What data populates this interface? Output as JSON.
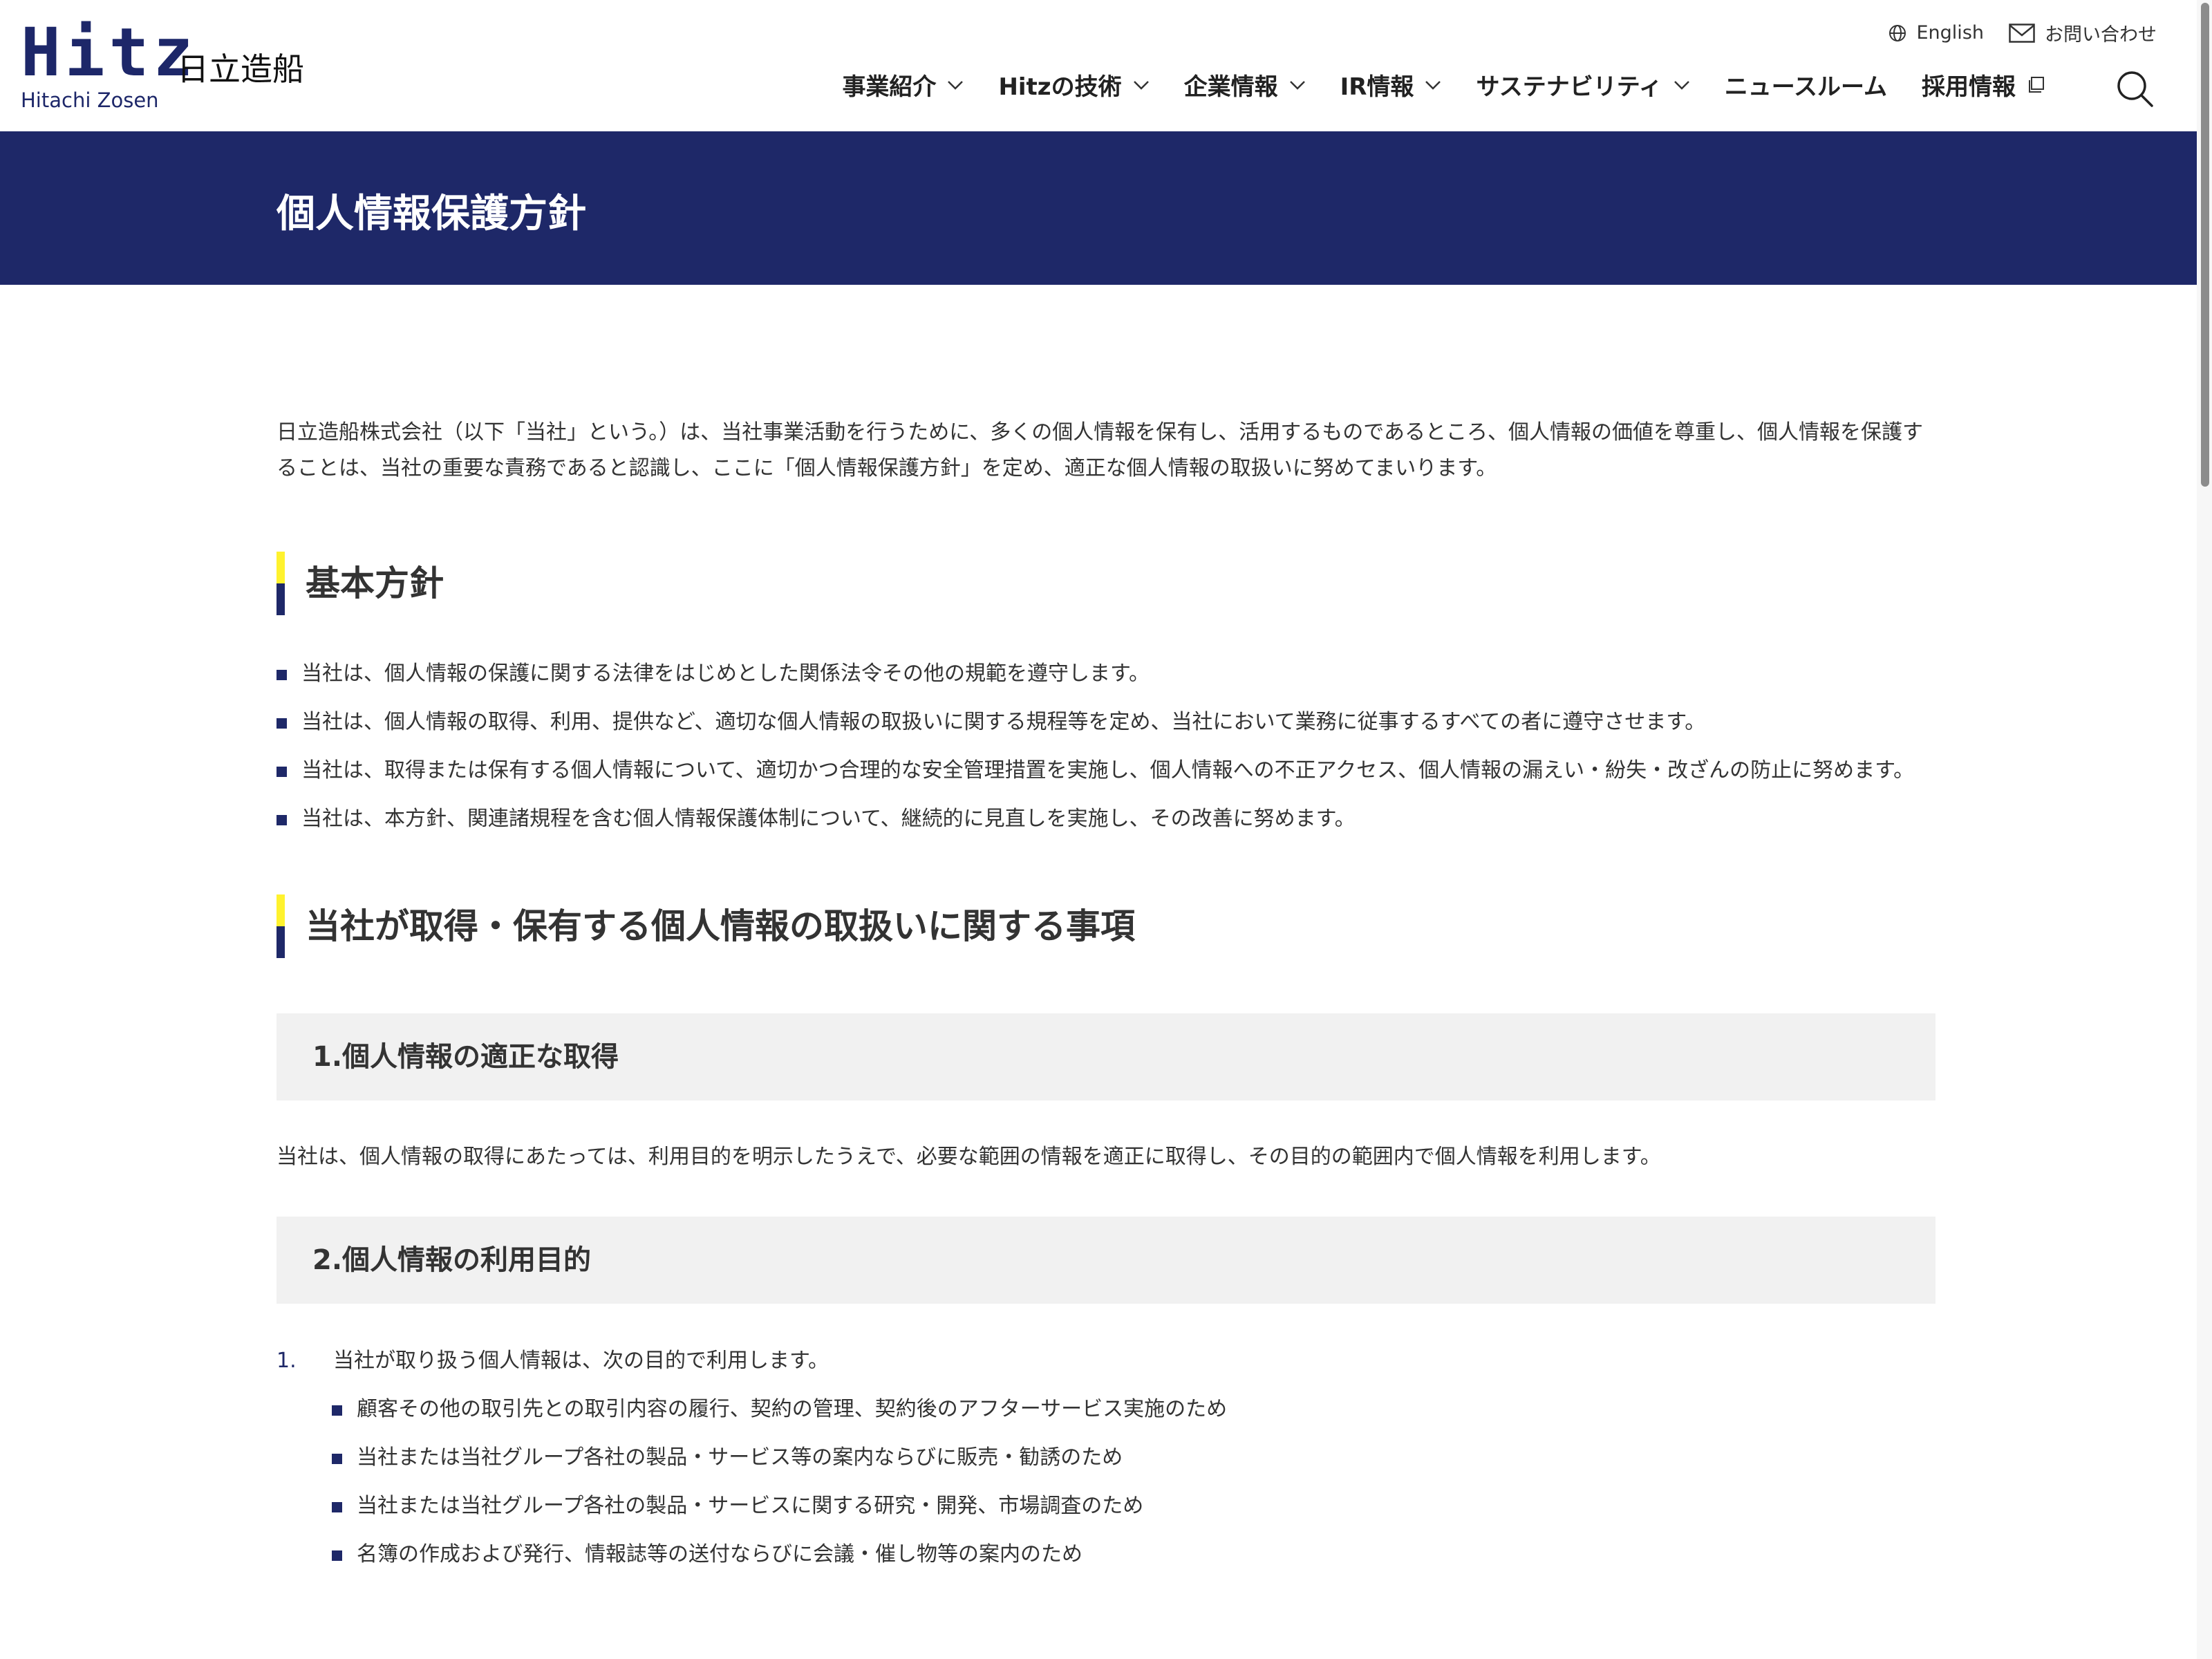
{
  "header": {
    "logo": {
      "mark": "Hitz",
      "name_jp": "日立造船",
      "name_en": "Hitachi Zosen"
    },
    "utility": {
      "english": {
        "label": "English",
        "icon": "globe-icon"
      },
      "contact": {
        "label": "お問い合わせ",
        "icon": "mail-icon"
      }
    },
    "nav": [
      {
        "label": "事業紹介",
        "dropdown": true
      },
      {
        "label": "Hitzの技術",
        "dropdown": true
      },
      {
        "label": "企業情報",
        "dropdown": true
      },
      {
        "label": "IR情報",
        "dropdown": true
      },
      {
        "label": "サステナビリティ",
        "dropdown": true
      },
      {
        "label": "ニュースルーム",
        "dropdown": false
      },
      {
        "label": "採用情報",
        "external": true
      }
    ],
    "search_icon": "search-icon"
  },
  "page_title": "個人情報保護方針",
  "intro": "日立造船株式会社（以下「当社」という。）は、当社事業活動を行うために、多くの個人情報を保有し、活用するものであるところ、個人情報の価値を尊重し、個人情報を保護することは、当社の重要な責務であると認識し、ここに「個人情報保護方針」を定め、適正な個人情報の取扱いに努めてまいります。",
  "basic_policy": {
    "heading": "基本方針",
    "items": [
      "当社は、個人情報の保護に関する法律をはじめとした関係法令その他の規範を遵守します。",
      "当社は、個人情報の取得、利用、提供など、適切な個人情報の取扱いに関する規程等を定め、当社において業務に従事するすべての者に遵守させます。",
      "当社は、取得または保有する個人情報について、適切かつ合理的な安全管理措置を実施し、個人情報への不正アクセス、個人情報の漏えい・紛失・改ざんの防止に努めます。",
      "当社は、本方針、関連諸規程を含む個人情報保護体制について、継続的に見直しを実施し、その改善に努めます。"
    ]
  },
  "handling": {
    "heading": "当社が取得・保有する個人情報の取扱いに関する事項",
    "sections": [
      {
        "title": "1.個人情報の適正な取得",
        "body": "当社は、個人情報の取得にあたっては、利用目的を明示したうえで、必要な範囲の情報を適正に取得し、その目的の範囲内で個人情報を利用します。"
      },
      {
        "title": "2.個人情報の利用目的",
        "list": [
          {
            "num": "1.",
            "text": "当社が取り扱う個人情報は、次の目的で利用します。",
            "items": [
              "顧客その他の取引先との取引内容の履行、契約の管理、契約後のアフターサービス実施のため",
              "当社または当社グループ各社の製品・サービス等の案内ならびに販売・勧誘のため",
              "当社または当社グループ各社の製品・サービスに関する研究・開発、市場調査のため",
              "名簿の作成および発行、情報誌等の送付ならびに会議・催し物等の案内のため"
            ]
          }
        ]
      }
    ]
  },
  "colors": {
    "brand_navy": "#1e2868",
    "accent_yellow": "#fff22e",
    "section_bg": "#f1f1f1"
  }
}
